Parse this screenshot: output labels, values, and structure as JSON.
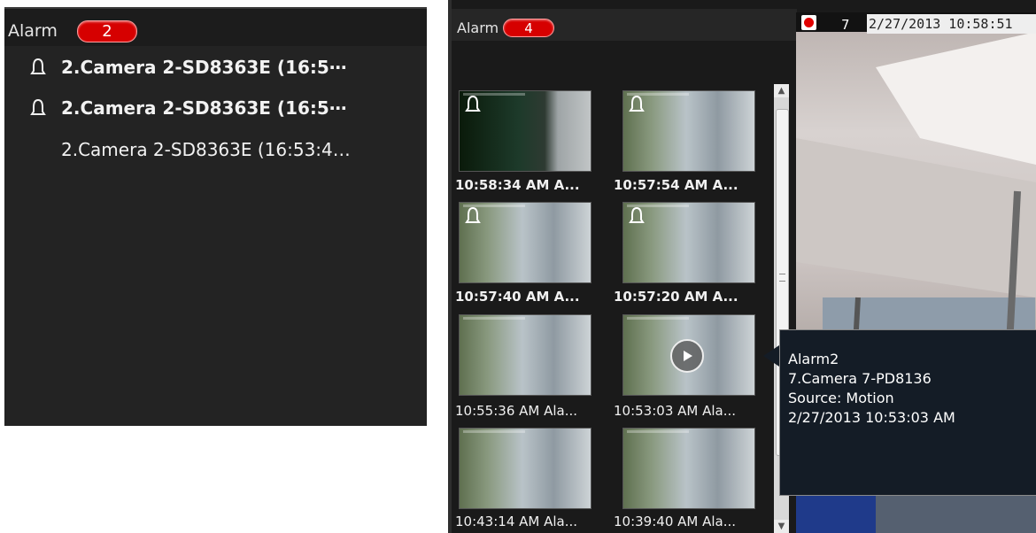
{
  "colors": {
    "badge_red": "#d60000",
    "panel_bg": "#232323",
    "tooltip_bg": "#141c26"
  },
  "left_panel": {
    "title": "Alarm",
    "badge_count": "2",
    "items": [
      {
        "label": "2.Camera 2-SD8363E (16:5⋯",
        "icon": "bell-icon",
        "unread": true
      },
      {
        "label": "2.Camera 2-SD8363E (16:5⋯",
        "icon": "bell-icon",
        "unread": true
      },
      {
        "label": "2.Camera 2-SD8363E (16:53:4…",
        "icon": "",
        "unread": false
      }
    ]
  },
  "right_panel": {
    "title": "Alarm",
    "badge_count": "4",
    "camera_view": {
      "channel": "7",
      "timestamp": "2/27/2013 10:58:51",
      "recording_icon": "record-icon"
    },
    "thumbnails": [
      {
        "caption": "10:58:34 AM A...",
        "bell": true,
        "unread": true
      },
      {
        "caption": "10:57:54 AM A...",
        "bell": true,
        "unread": true
      },
      {
        "caption": "10:57:40 AM A...",
        "bell": true,
        "unread": true
      },
      {
        "caption": "10:57:20 AM A...",
        "bell": true,
        "unread": true
      },
      {
        "caption": "10:55:36 AM Ala...",
        "bell": false,
        "unread": false
      },
      {
        "caption": "10:53:03 AM Ala...",
        "bell": false,
        "unread": false,
        "play": true
      },
      {
        "caption": "10:43:14 AM Ala...",
        "bell": false,
        "unread": false
      },
      {
        "caption": "10:39:40 AM Ala...",
        "bell": false,
        "unread": false
      }
    ],
    "tooltip": {
      "name": "Alarm2",
      "camera": "7.Camera 7-PD8136",
      "source": "Source: Motion",
      "time": "2/27/2013 10:53:03 AM"
    }
  }
}
